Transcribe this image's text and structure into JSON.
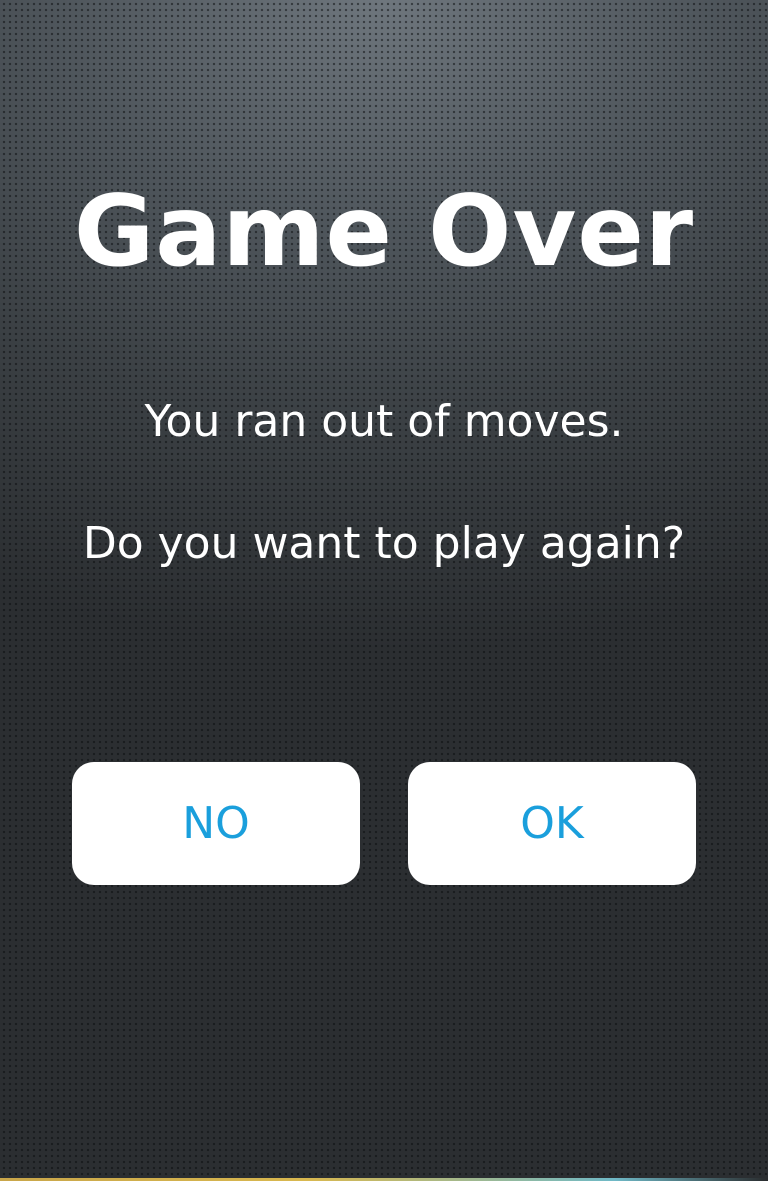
{
  "dialog": {
    "title": "Game Over",
    "message_line1": "You ran out of moves.",
    "message_line2": "Do you want to play again?"
  },
  "buttons": {
    "no_label": "NO",
    "ok_label": "OK"
  },
  "colors": {
    "button_text": "#1a9fdc",
    "button_background": "#ffffff",
    "text": "#ffffff",
    "background": "#3a3d40"
  }
}
